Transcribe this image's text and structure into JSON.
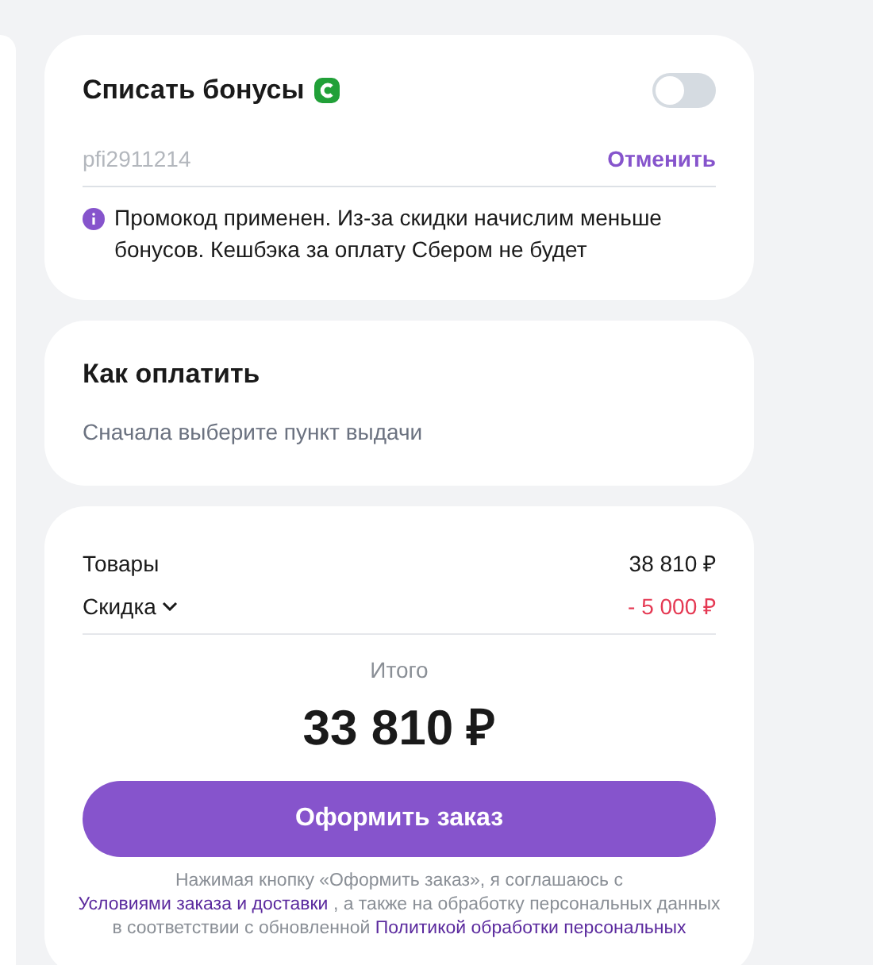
{
  "bonuses": {
    "title": "Списать бонусы",
    "switch_on": false,
    "promo_code": "pfi2911214",
    "cancel_link": "Отменить",
    "notice": "Промокод применен. Из-за скидки начислим меньше бонусов. Кешбэка за оплату Сбером не будет"
  },
  "payment": {
    "title": "Как оплатить",
    "hint": "Сначала выберите пункт выдачи"
  },
  "summary": {
    "lines": [
      {
        "kind": "plain",
        "label": "Товары",
        "value": "38 810 ₽"
      },
      {
        "kind": "discount",
        "label": "Скидка",
        "value": "- 5 000 ₽"
      }
    ],
    "total_label": "Итого",
    "total": "33 810 ₽",
    "submit": "Оформить заказ",
    "legal": [
      {
        "kind": "text",
        "text": "Нажимая кнопку «Оформить заказ», я соглашаюсь с"
      },
      {
        "kind": "link",
        "text": "Условиями заказа и доставки"
      },
      {
        "kind": "text",
        "text": ", а также на обработку персональных данных в соответствии с обновленной"
      },
      {
        "kind": "link",
        "text": "Политикой обработки персональных"
      }
    ]
  }
}
